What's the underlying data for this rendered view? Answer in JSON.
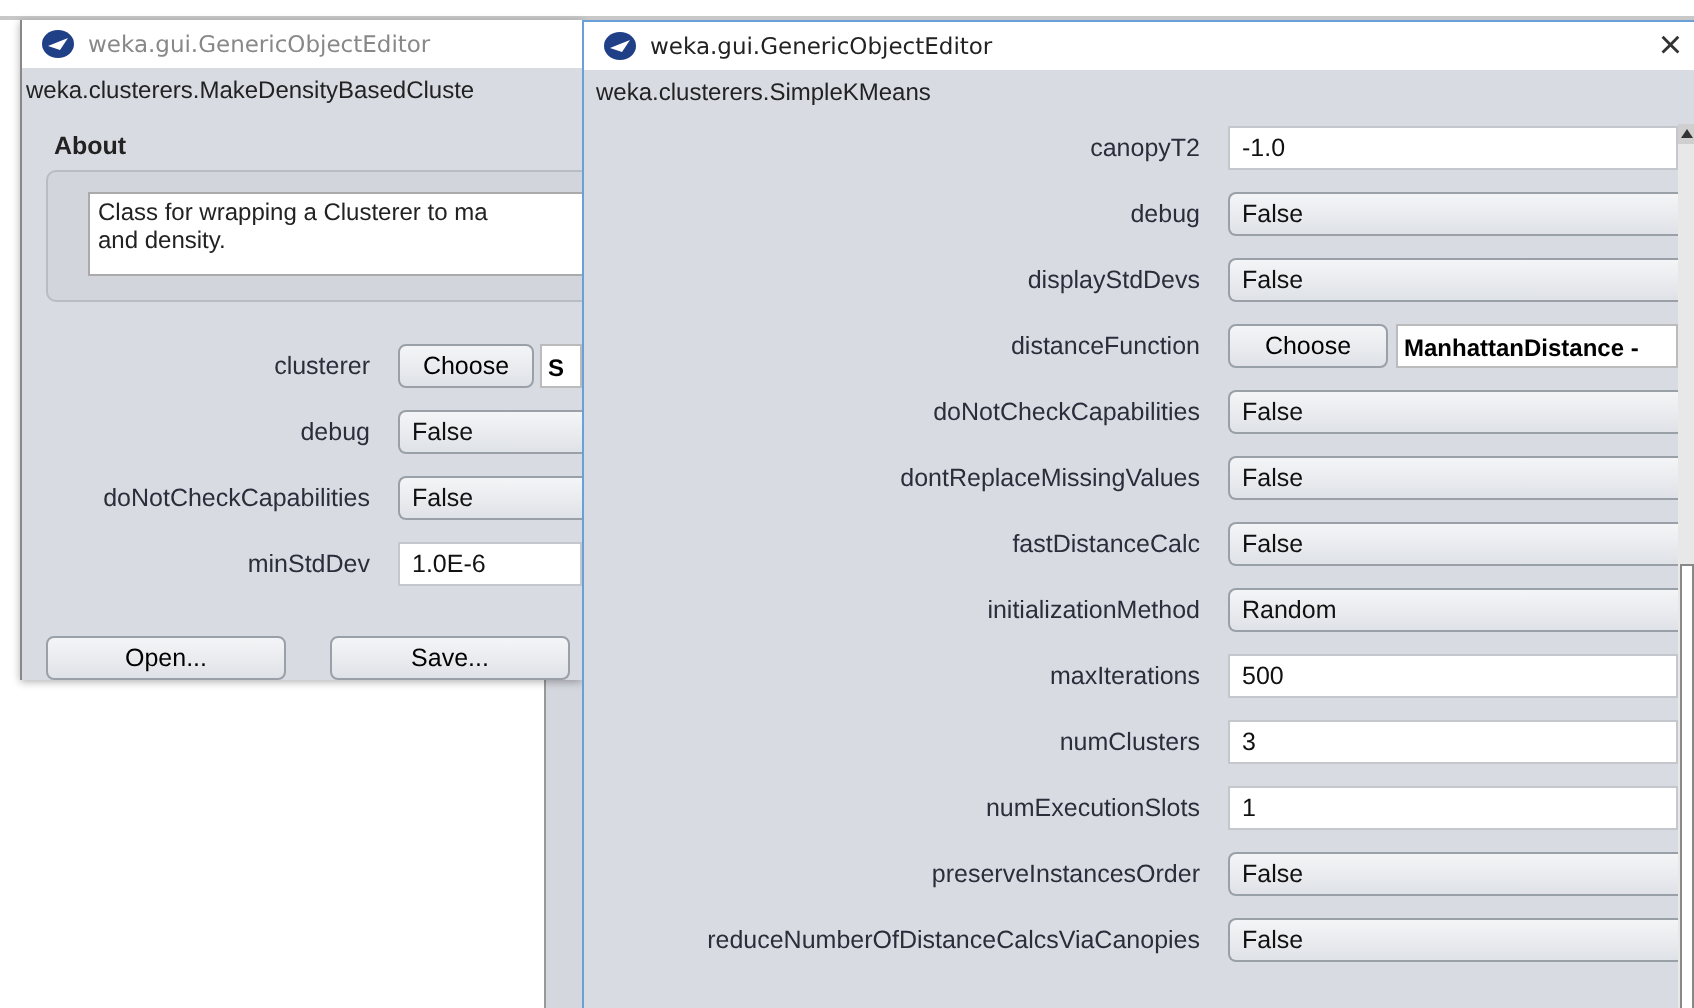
{
  "back_window": {
    "title": "weka.gui.GenericObjectEditor",
    "class_name": "weka.clusterers.MakeDensityBasedCluste",
    "about_heading": "About",
    "about_text": "Class for wrapping a Clusterer to ma\nand density.",
    "properties": [
      {
        "kind": "choose",
        "label": "clusterer",
        "button": "Choose",
        "value": "S"
      },
      {
        "kind": "dropdown",
        "label": "debug",
        "value": "False"
      },
      {
        "kind": "dropdown",
        "label": "doNotCheckCapabilities",
        "value": "False"
      },
      {
        "kind": "text",
        "label": "minStdDev",
        "value": "1.0E-6"
      }
    ],
    "buttons": [
      "Open...",
      "Save..."
    ]
  },
  "front_window": {
    "title": "weka.gui.GenericObjectEditor",
    "close": "×",
    "class_name": "weka.clusterers.SimpleKMeans",
    "properties": [
      {
        "kind": "text",
        "label": "canopyT2",
        "value": "-1.0"
      },
      {
        "kind": "dropdown",
        "label": "debug",
        "value": "False"
      },
      {
        "kind": "dropdown",
        "label": "displayStdDevs",
        "value": "False"
      },
      {
        "kind": "choose",
        "label": "distanceFunction",
        "button": "Choose",
        "value": "ManhattanDistance -"
      },
      {
        "kind": "dropdown",
        "label": "doNotCheckCapabilities",
        "value": "False"
      },
      {
        "kind": "dropdown",
        "label": "dontReplaceMissingValues",
        "value": "False"
      },
      {
        "kind": "dropdown",
        "label": "fastDistanceCalc",
        "value": "False"
      },
      {
        "kind": "dropdown",
        "label": "initializationMethod",
        "value": "Random"
      },
      {
        "kind": "text",
        "label": "maxIterations",
        "value": "500"
      },
      {
        "kind": "text",
        "label": "numClusters",
        "value": "3"
      },
      {
        "kind": "text",
        "label": "numExecutionSlots",
        "value": "1"
      },
      {
        "kind": "dropdown",
        "label": "preserveInstancesOrder",
        "value": "False"
      },
      {
        "kind": "dropdown",
        "label": "reduceNumberOfDistanceCalcsViaCanopies",
        "value": "False"
      }
    ]
  }
}
